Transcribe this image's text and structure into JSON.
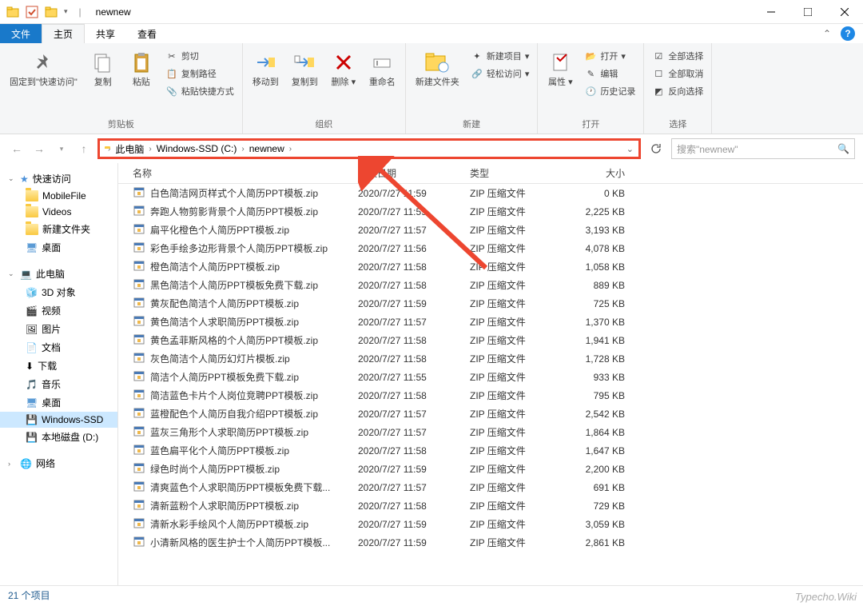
{
  "window": {
    "title": "newnew"
  },
  "tabs": {
    "file": "文件",
    "home": "主页",
    "share": "共享",
    "view": "查看"
  },
  "ribbon": {
    "clipboard": {
      "pin": "固定到\"快速访问\"",
      "copy": "复制",
      "paste": "粘贴",
      "cut": "剪切",
      "copy_path": "复制路径",
      "paste_shortcut": "粘贴快捷方式",
      "label": "剪贴板"
    },
    "organize": {
      "move_to": "移动到",
      "copy_to": "复制到",
      "delete": "删除",
      "rename": "重命名",
      "label": "组织"
    },
    "new": {
      "new_folder": "新建文件夹",
      "new_item": "新建项目",
      "easy_access": "轻松访问",
      "label": "新建"
    },
    "open": {
      "properties": "属性",
      "open": "打开",
      "edit": "编辑",
      "history": "历史记录",
      "label": "打开"
    },
    "select": {
      "select_all": "全部选择",
      "select_none": "全部取消",
      "invert": "反向选择",
      "label": "选择"
    }
  },
  "breadcrumb": {
    "this_pc": "此电脑",
    "drive": "Windows-SSD (C:)",
    "folder": "newnew"
  },
  "search": {
    "placeholder": "搜索\"newnew\""
  },
  "sidebar": {
    "quick_access": "快速访问",
    "mobile_file": "MobileFile",
    "videos": "Videos",
    "new_folder": "新建文件夹",
    "desktop": "桌面",
    "this_pc": "此电脑",
    "objects_3d": "3D 对象",
    "videos2": "视频",
    "pictures": "图片",
    "documents": "文档",
    "downloads": "下载",
    "music": "音乐",
    "desktop2": "桌面",
    "c_drive": "Windows-SSD",
    "d_drive": "本地磁盘 (D:)",
    "network": "网络"
  },
  "columns": {
    "name": "名称",
    "date": "修改日期",
    "type": "类型",
    "size": "大小"
  },
  "files": [
    {
      "name": "白色简洁网页样式个人简历PPT模板.zip",
      "date": "2020/7/27 11:59",
      "type": "ZIP 压缩文件",
      "size": "0 KB"
    },
    {
      "name": "奔跑人物剪影背景个人简历PPT模板.zip",
      "date": "2020/7/27 11:59",
      "type": "ZIP 压缩文件",
      "size": "2,225 KB"
    },
    {
      "name": "扁平化橙色个人简历PPT模板.zip",
      "date": "2020/7/27 11:57",
      "type": "ZIP 压缩文件",
      "size": "3,193 KB"
    },
    {
      "name": "彩色手绘多边形背景个人简历PPT模板.zip",
      "date": "2020/7/27 11:56",
      "type": "ZIP 压缩文件",
      "size": "4,078 KB"
    },
    {
      "name": "橙色简洁个人简历PPT模板.zip",
      "date": "2020/7/27 11:58",
      "type": "ZIP 压缩文件",
      "size": "1,058 KB"
    },
    {
      "name": "黑色简洁个人简历PPT模板免费下载.zip",
      "date": "2020/7/27 11:58",
      "type": "ZIP 压缩文件",
      "size": "889 KB"
    },
    {
      "name": "黄灰配色简洁个人简历PPT模板.zip",
      "date": "2020/7/27 11:59",
      "type": "ZIP 压缩文件",
      "size": "725 KB"
    },
    {
      "name": "黄色简洁个人求职简历PPT模板.zip",
      "date": "2020/7/27 11:57",
      "type": "ZIP 压缩文件",
      "size": "1,370 KB"
    },
    {
      "name": "黄色孟菲斯风格的个人简历PPT模板.zip",
      "date": "2020/7/27 11:58",
      "type": "ZIP 压缩文件",
      "size": "1,941 KB"
    },
    {
      "name": "灰色简洁个人简历幻灯片模板.zip",
      "date": "2020/7/27 11:58",
      "type": "ZIP 压缩文件",
      "size": "1,728 KB"
    },
    {
      "name": "简洁个人简历PPT模板免费下载.zip",
      "date": "2020/7/27 11:55",
      "type": "ZIP 压缩文件",
      "size": "933 KB"
    },
    {
      "name": "简洁蓝色卡片个人岗位竞聘PPT模板.zip",
      "date": "2020/7/27 11:58",
      "type": "ZIP 压缩文件",
      "size": "795 KB"
    },
    {
      "name": "蓝橙配色个人简历自我介绍PPT模板.zip",
      "date": "2020/7/27 11:57",
      "type": "ZIP 压缩文件",
      "size": "2,542 KB"
    },
    {
      "name": "蓝灰三角形个人求职简历PPT模板.zip",
      "date": "2020/7/27 11:57",
      "type": "ZIP 压缩文件",
      "size": "1,864 KB"
    },
    {
      "name": "蓝色扁平化个人简历PPT模板.zip",
      "date": "2020/7/27 11:58",
      "type": "ZIP 压缩文件",
      "size": "1,647 KB"
    },
    {
      "name": "绿色时尚个人简历PPT模板.zip",
      "date": "2020/7/27 11:59",
      "type": "ZIP 压缩文件",
      "size": "2,200 KB"
    },
    {
      "name": "清爽蓝色个人求职简历PPT模板免费下载...",
      "date": "2020/7/27 11:57",
      "type": "ZIP 压缩文件",
      "size": "691 KB"
    },
    {
      "name": "清新蓝粉个人求职简历PPT模板.zip",
      "date": "2020/7/27 11:58",
      "type": "ZIP 压缩文件",
      "size": "729 KB"
    },
    {
      "name": "清新水彩手绘风个人简历PPT模板.zip",
      "date": "2020/7/27 11:59",
      "type": "ZIP 压缩文件",
      "size": "3,059 KB"
    },
    {
      "name": "小清新风格的医生护士个人简历PPT模板...",
      "date": "2020/7/27 11:59",
      "type": "ZIP 压缩文件",
      "size": "2,861 KB"
    }
  ],
  "status": {
    "items": "21 个项目"
  },
  "watermark": "Typecho.Wiki"
}
